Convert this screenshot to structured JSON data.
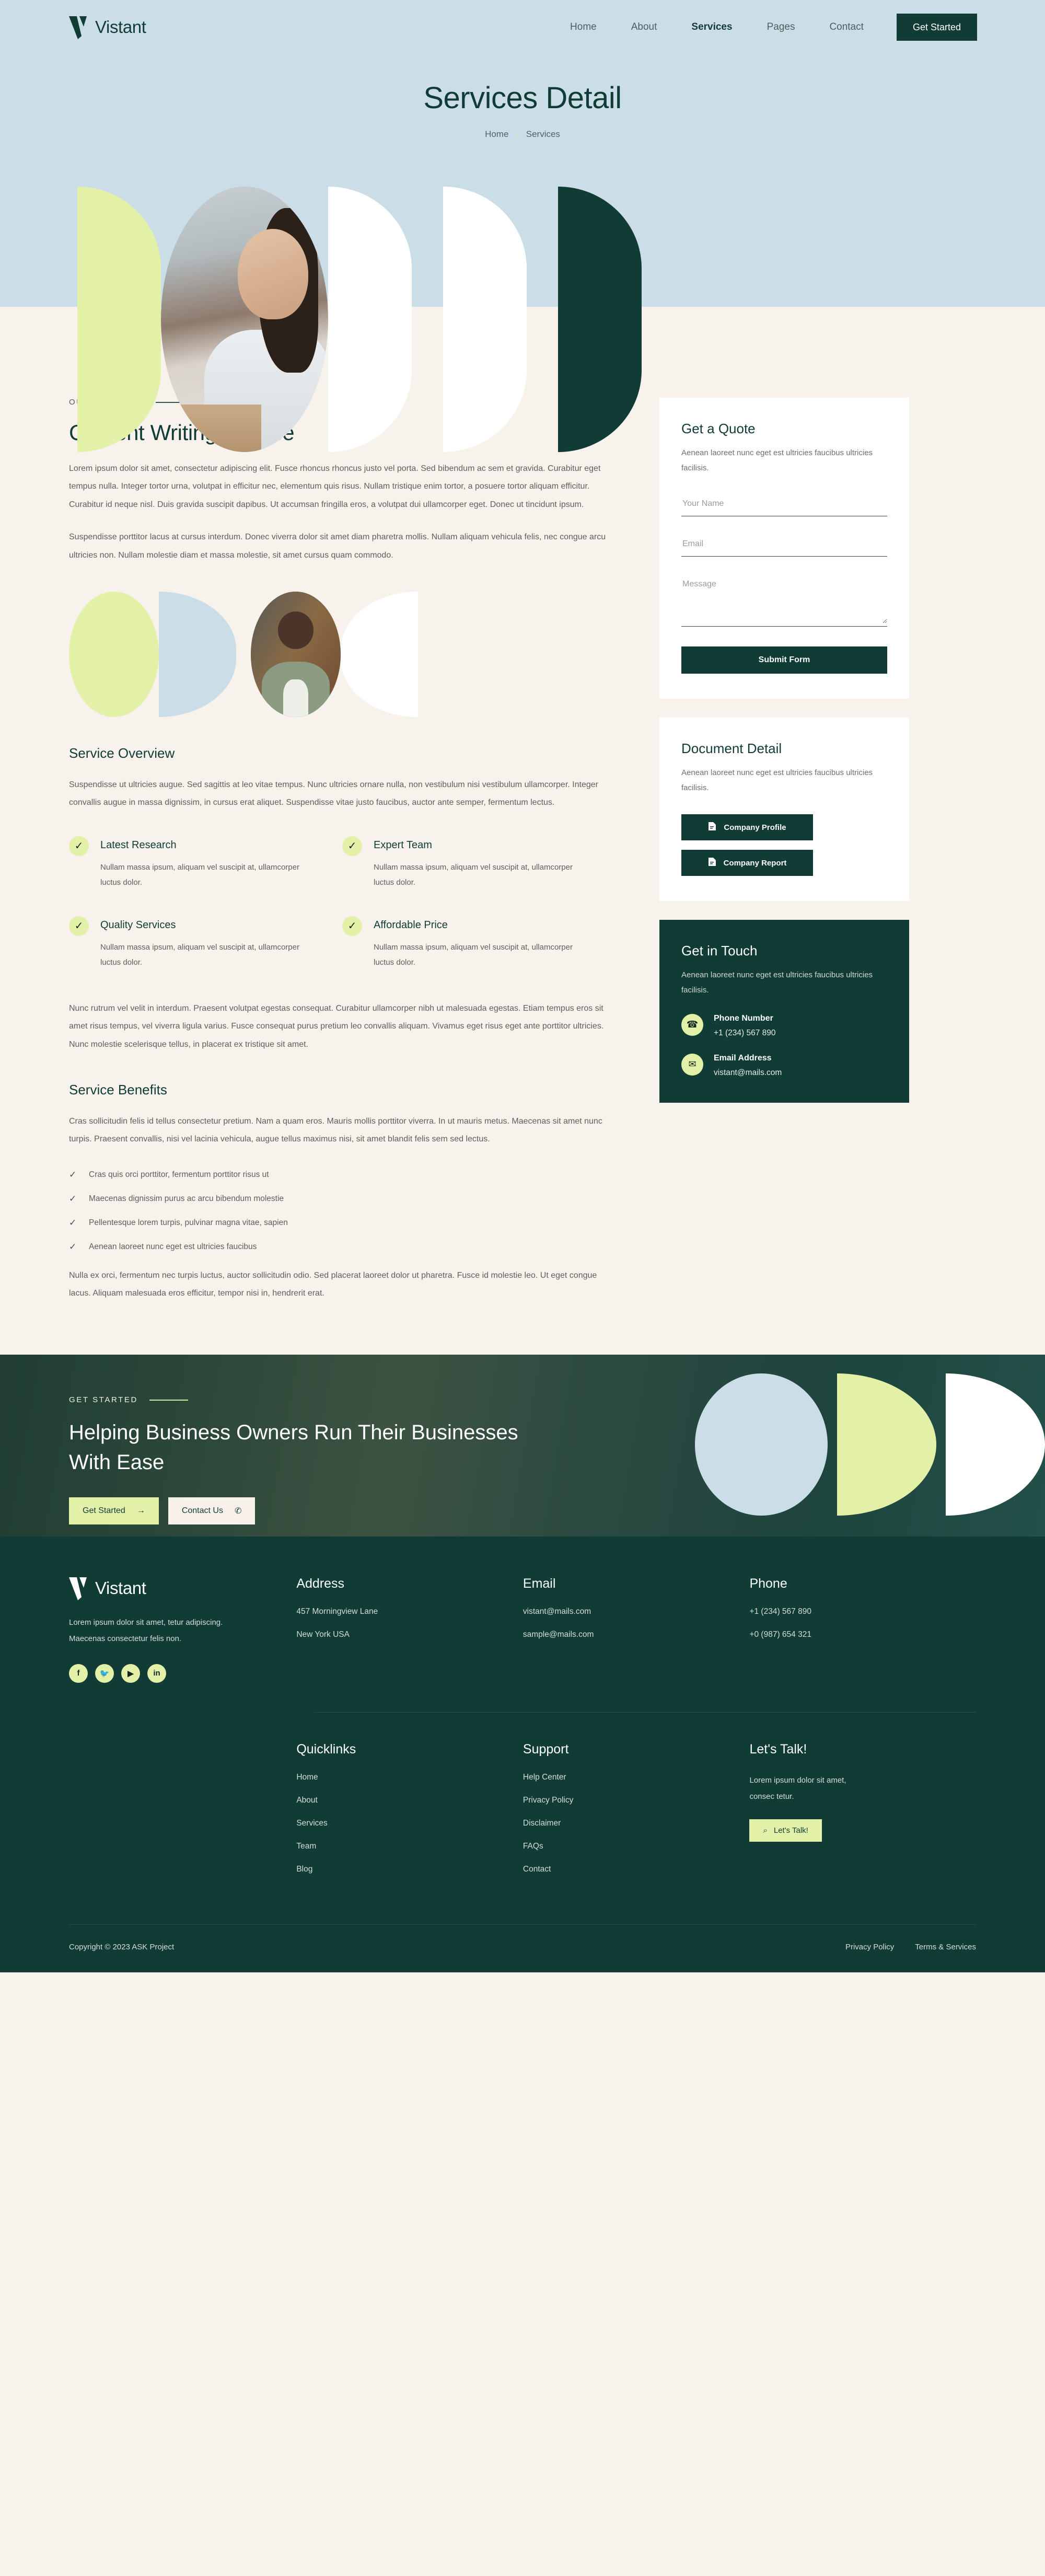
{
  "brand": {
    "name": "Vistant",
    "logo_icon": "v-logo-icon"
  },
  "nav": {
    "links": [
      {
        "label": "Home",
        "active": false
      },
      {
        "label": "About",
        "active": false
      },
      {
        "label": "Services",
        "active": true
      },
      {
        "label": "Pages",
        "active": false
      },
      {
        "label": "Contact",
        "active": false
      }
    ],
    "cta_label": "Get Started"
  },
  "hero": {
    "title": "Services Detail",
    "breadcrumb": {
      "home": "Home",
      "separator": "›",
      "current": "Services"
    }
  },
  "article": {
    "eyebrow": "OUR SERVICES",
    "title": "Content Writing Service",
    "paragraph_1": "Lorem ipsum dolor sit amet, consectetur adipiscing elit. Fusce rhoncus rhoncus justo vel porta. Sed bibendum ac sem et gravida. Curabitur eget tempus nulla. Integer tortor urna, volutpat in efficitur nec, elementum quis risus. Nullam tristique enim tortor, a posuere tortor aliquam efficitur. Curabitur id neque nisl. Duis gravida suscipit dapibus. Ut accumsan fringilla eros, a volutpat dui ullamcorper eget. Donec ut tincidunt ipsum.",
    "paragraph_2": "Suspendisse porttitor lacus at cursus interdum. Donec viverra dolor sit amet diam pharetra mollis. Nullam aliquam vehicula felis, nec congue arcu ultricies non. Nullam molestie diam et massa molestie, sit amet cursus quam commodo.",
    "overview_title": "Service Overview",
    "overview_paragraph": "Suspendisse ut ultricies augue. Sed sagittis at leo vitae tempus. Nunc ultricies ornare nulla, non vestibulum nisi vestibulum ullamcorper. Integer convallis augue in massa dignissim, in cursus erat aliquet. Suspendisse vitae justo faucibus, auctor ante semper, fermentum lectus.",
    "features": [
      {
        "title": "Latest Research",
        "desc": "Nullam massa ipsum, aliquam vel suscipit at, ullamcorper luctus dolor."
      },
      {
        "title": "Expert Team",
        "desc": "Nullam massa ipsum, aliquam vel suscipit at, ullamcorper luctus dolor."
      },
      {
        "title": "Quality Services",
        "desc": "Nullam massa ipsum, aliquam vel suscipit at, ullamcorper luctus dolor."
      },
      {
        "title": "Affordable Price",
        "desc": "Nullam massa ipsum, aliquam vel suscipit at, ullamcorper luctus dolor."
      }
    ],
    "paragraph_3": "Nunc rutrum vel velit in interdum. Praesent volutpat egestas consequat. Curabitur ullamcorper nibh ut malesuada egestas. Etiam tempus eros sit amet risus tempus, vel viverra ligula varius. Fusce consequat purus pretium leo convallis aliquam. Vivamus eget risus eget ante porttitor ultricies. Nunc molestie scelerisque tellus, in placerat ex tristique sit amet.",
    "benefits_title": "Service Benefits",
    "benefits_paragraph": "Cras sollicitudin felis id tellus consectetur pretium. Nam a quam eros. Mauris mollis porttitor viverra. In ut mauris metus. Maecenas sit amet nunc turpis. Praesent convallis, nisi vel lacinia vehicula, augue tellus maximus nisi, sit amet blandit felis sem sed lectus.",
    "benefits_list": [
      "Cras quis orci porttitor, fermentum porttitor risus ut",
      "Maecenas dignissim purus ac arcu bibendum molestie",
      "Pellentesque lorem turpis, pulvinar magna vitae, sapien",
      "Aenean laoreet nunc eget est ultricies faucibus"
    ],
    "paragraph_4": "Nulla ex orci, fermentum nec turpis luctus, auctor sollicitudin odio. Sed placerat laoreet dolor ut pharetra. Fusce id molestie leo. Ut eget congue lacus. Aliquam malesuada eros efficitur, tempor nisi in, hendrerit erat."
  },
  "quote_form": {
    "title": "Get a Quote",
    "subtitle": "Aenean laoreet nunc eget est ultricies faucibus ultricies facilisis.",
    "name_placeholder": "Your Name",
    "email_placeholder": "Email",
    "message_placeholder": "Message",
    "submit_label": "Submit Form"
  },
  "document_detail": {
    "title": "Document Detail",
    "subtitle": "Aenean laoreet nunc eget est ultricies faucibus ultricies facilisis.",
    "buttons": [
      {
        "label": "Company Profile",
        "icon": "document-icon"
      },
      {
        "label": "Company Report",
        "icon": "document-icon"
      }
    ]
  },
  "get_in_touch": {
    "title": "Get in Touch",
    "subtitle": "Aenean laoreet nunc eget est ultricies faucibus ultricies facilisis.",
    "phone_label": "Phone Number",
    "phone_value": "+1 (234) 567 890",
    "email_label": "Email Address",
    "email_value": "vistant@mails.com"
  },
  "cta": {
    "eyebrow": "GET STARTED",
    "title": "Helping Business Owners Run Their Businesses With Ease",
    "primary_label": "Get Started",
    "primary_icon": "→",
    "secondary_label": "Contact Us",
    "secondary_icon": "✆"
  },
  "footer": {
    "about_text": "Lorem ipsum dolor sit amet, tetur adipiscing. Maecenas consectetur felis non.",
    "socials": [
      {
        "name": "facebook-icon",
        "glyph": "f"
      },
      {
        "name": "twitter-icon",
        "glyph": "🐦"
      },
      {
        "name": "youtube-icon",
        "glyph": "▶"
      },
      {
        "name": "linkedin-icon",
        "glyph": "in"
      }
    ],
    "address": {
      "heading": "Address",
      "line1": "457 Morningview Lane",
      "line2": "New York USA"
    },
    "email": {
      "heading": "Email",
      "line1": "vistant@mails.com",
      "line2": "sample@mails.com"
    },
    "phone": {
      "heading": "Phone",
      "line1": "+1 (234) 567 890",
      "line2": "+0 (987) 654 321"
    },
    "quicklinks": {
      "heading": "Quicklinks",
      "items": [
        "Home",
        "About",
        "Services",
        "Team",
        "Blog"
      ]
    },
    "support": {
      "heading": "Support",
      "items": [
        "Help Center",
        "Privacy Policy",
        "Disclaimer",
        "FAQs",
        "Contact"
      ]
    },
    "lets_talk": {
      "heading": "Let's Talk!",
      "text": "Lorem ipsum dolor sit amet, consec tetur.",
      "button_label": "Let's Talk!",
      "button_icon": "⌕"
    },
    "copyright": "Copyright © 2023 ASK Project",
    "bottom_links": [
      "Privacy Policy",
      "Terms & Services"
    ]
  },
  "colors": {
    "dark_green": "#103c35",
    "lime": "#e2f0a8",
    "pale_blue": "#cbdde6",
    "cream": "#f7f2ec"
  }
}
